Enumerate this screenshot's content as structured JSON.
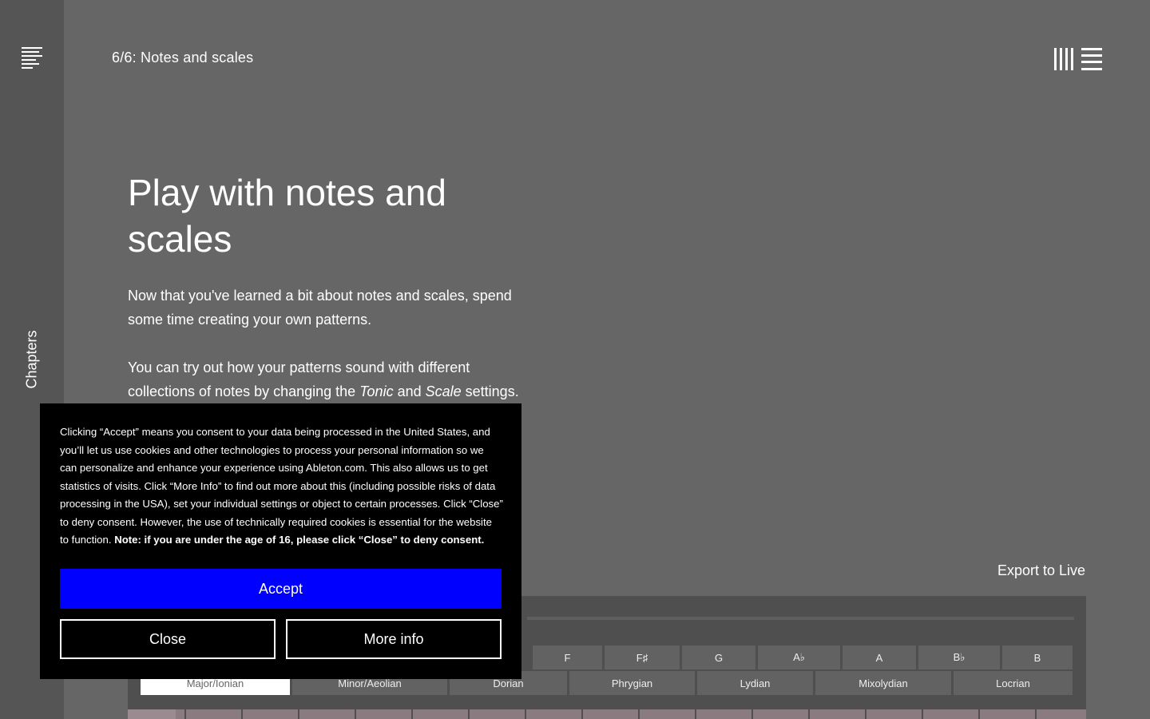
{
  "sidebar": {
    "menu_icon": "hamburger-menu-icon",
    "chapters_label": "Chapters"
  },
  "header": {
    "chapter_title": "6/6: Notes and scales",
    "logo_icon": "ableton-logo-icon"
  },
  "main": {
    "headline": "Play with notes and scales",
    "paragraph1": "Now that you've learned a bit about notes and scales, spend some time creating your own patterns.",
    "paragraph2": {
      "before": "You can try out how your patterns sound with different collections of notes by changing the ",
      "tonic": "Tonic",
      "middle": " and ",
      "scale": "Scale",
      "after": " settings."
    },
    "export_label": "Export to Live"
  },
  "app": {
    "tonics": [
      "F",
      "F♯",
      "G",
      "A♭",
      "A",
      "B♭",
      "B"
    ],
    "scales": [
      "Major/Ionian",
      "Minor/Aeolian",
      "Dorian",
      "Phrygian",
      "Lydian",
      "Mixolydian",
      "Locrian"
    ],
    "selected_scale": "Major/Ionian"
  },
  "cookie": {
    "text_plain": "Clicking “Accept” means you consent to your data being processed in the United States, and you’ll let us use cookies and other technologies to process your personal information so we can personalize and enhance your experience using Ableton.com. This also allows us to get statistics of visits. Click “More Info” to find out more about this (including possible risks of data processing in the USA), set your individual settings or object to certain processes. Click “Close” to deny consent. However, the use of technically required cookies is essential for the website to function. ",
    "text_bold": "Note: if you are under the age of 16, please click “Close” to deny consent.",
    "accept_label": "Accept",
    "close_label": "Close",
    "more_label": "More info"
  },
  "colors": {
    "background": "#666666",
    "sidebar": "#555555",
    "accept_button": "#0000ff",
    "cookie_panel": "#000000"
  }
}
